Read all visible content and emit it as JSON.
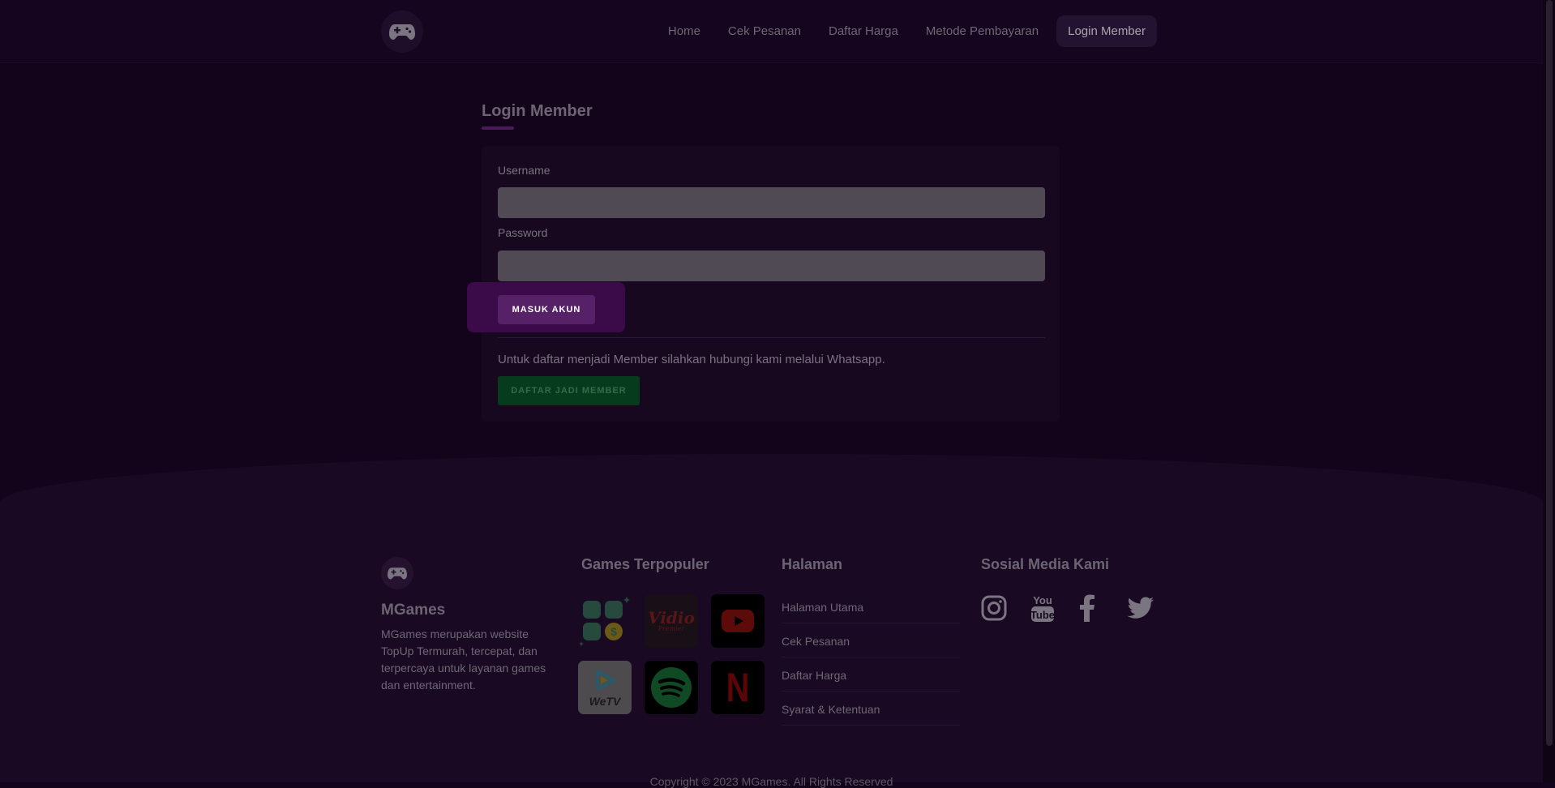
{
  "nav": {
    "items": [
      "Home",
      "Cek Pesanan",
      "Daftar Harga",
      "Metode Pembayaran"
    ],
    "active": "Login Member"
  },
  "login": {
    "title": "Login Member",
    "username_label": "Username",
    "username_value": "",
    "password_label": "Password",
    "password_value": "",
    "submit_label": "MASUK AKUN",
    "register_text": "Untuk daftar menjadi Member silahkan hubungi kami melalui Whatsapp.",
    "register_button": "DAFTAR JADI MEMBER"
  },
  "footer": {
    "brand": "MGames",
    "description": "MGames merupakan website TopUp Termurah, tercepat, dan terpercaya untuk layanan games dan entertainment.",
    "games_heading": "Games Terpopuler",
    "games": [
      "apps-coin-icon",
      "vidio-premier-icon",
      "youtube-icon",
      "wetv-icon",
      "spotify-icon",
      "netflix-icon"
    ],
    "game_labels": {
      "vidio": "Vidio",
      "vidio_sub": "Premier",
      "wetv": "WeTV",
      "netflix": "N"
    },
    "pages_heading": "Halaman",
    "pages": [
      "Halaman Utama",
      "Cek Pesanan",
      "Daftar Harga",
      "Syarat & Ketentuan"
    ],
    "social_heading": "Sosial Media Kami",
    "socials": [
      "instagram-icon",
      "youtube-icon",
      "facebook-icon",
      "twitter-icon"
    ],
    "copyright": "Copyright © 2023 MGames. All Rights Reserved"
  },
  "colors": {
    "background": "#13041c",
    "primary_button": "#562166",
    "success_button": "#063c1d",
    "input_fill": "#4f4a53"
  }
}
